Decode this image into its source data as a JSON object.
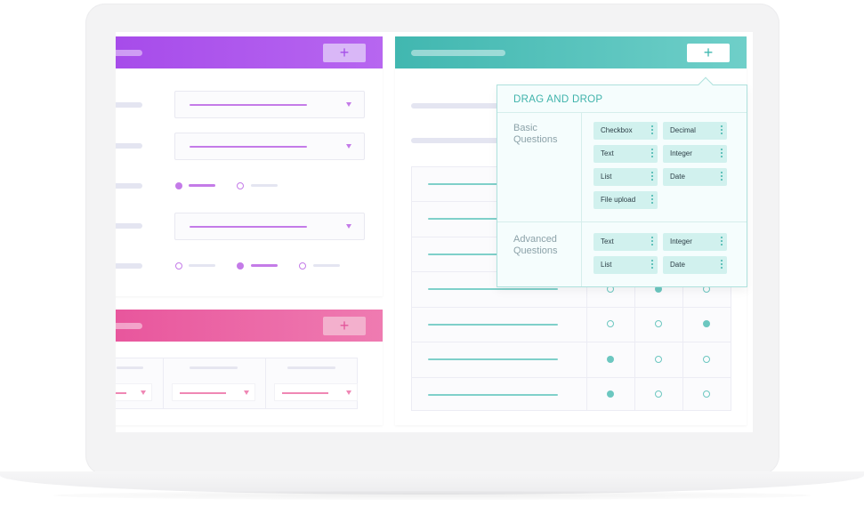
{
  "popover": {
    "title": "DRAG AND DROP",
    "sections": [
      {
        "label": "Basic Questions",
        "items": [
          "Checkbox",
          "Decimal",
          "Text",
          "Integer",
          "List",
          "Date",
          "File upload"
        ]
      },
      {
        "label": "Advanced Questions",
        "items": [
          "Text",
          "Integer",
          "List",
          "Date"
        ]
      }
    ]
  },
  "panels": {
    "form_panel": {
      "add_label": "+"
    },
    "grid_panel": {
      "add_label": "+"
    },
    "question_panel": {
      "add_label": "+"
    }
  },
  "colors": {
    "purple": "#a64bea",
    "pink": "#e8559c",
    "teal": "#41b7b0",
    "chip_bg": "#d1f1ee"
  },
  "icons": [
    "plus-icon",
    "kebab-icon",
    "dropdown-arrow-icon"
  ]
}
